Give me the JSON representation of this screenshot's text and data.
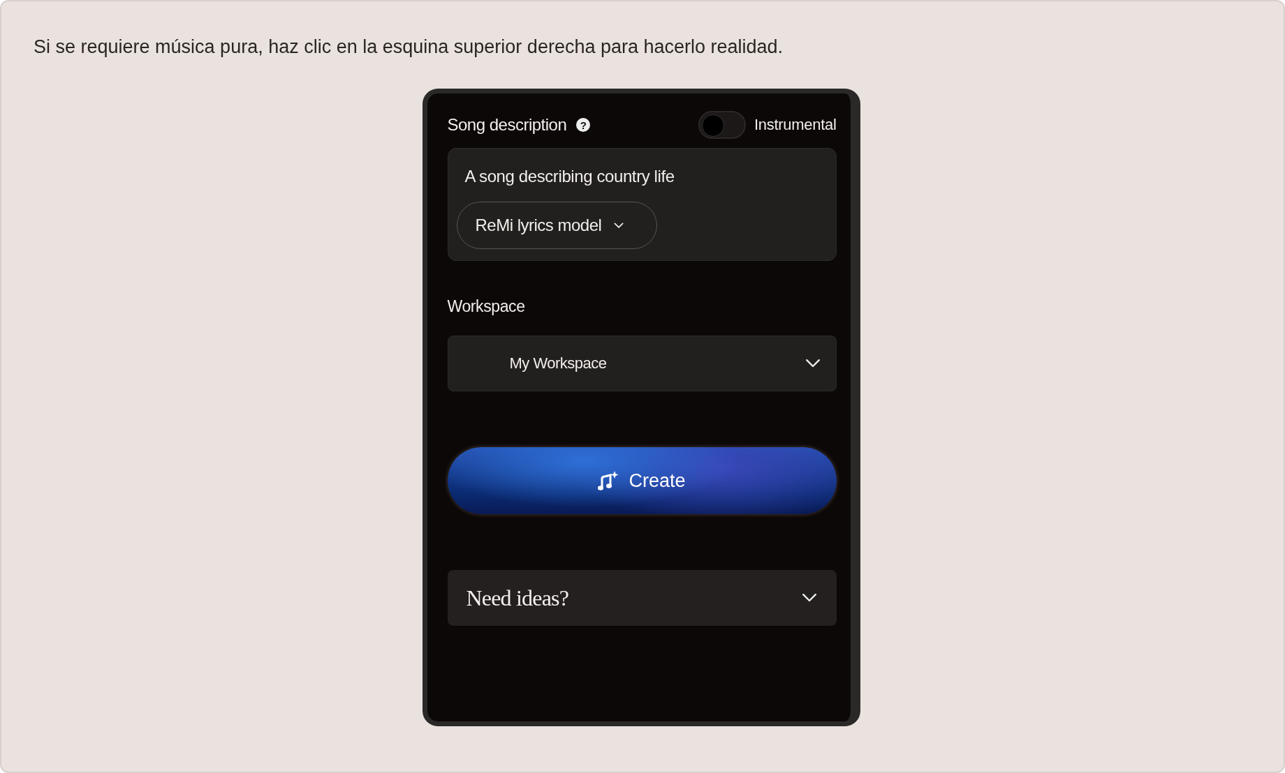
{
  "caption": "Si se requiere música pura, haz clic en la esquina superior derecha para hacerlo realidad.",
  "panel": {
    "description_label": "Song description",
    "help": "?",
    "instrumental": {
      "label": "Instrumental",
      "on": false
    },
    "prompt": "A song describing country life",
    "lyrics_model": "ReMi lyrics model",
    "workspace_label": "Workspace",
    "workspace": "My Workspace",
    "create_button": "Create",
    "ideas": {
      "label": "Need ideas?",
      "expanded": false
    }
  }
}
